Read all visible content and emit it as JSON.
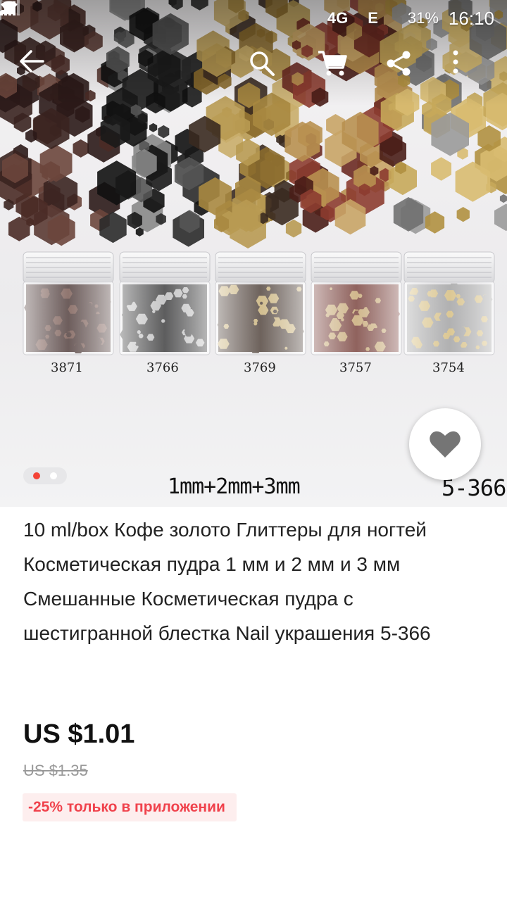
{
  "status_bar": {
    "network": "4G",
    "network_2": "E",
    "battery": "31%",
    "time": "16:10"
  },
  "toolbar": {
    "back_icon": "arrow-left-icon",
    "search_icon": "search-icon",
    "cart_icon": "cart-icon",
    "share_icon": "share-icon",
    "more_icon": "more-vertical-icon"
  },
  "gallery": {
    "image_count": 2,
    "active_index": 0,
    "jar_labels": [
      "3871",
      "3766",
      "3769",
      "3757",
      "3754"
    ],
    "caption_size": "1mm+2mm+3mm",
    "caption_code": "5-366"
  },
  "favorite": {
    "icon": "heart-icon"
  },
  "product": {
    "title": "10 ml/box Кофе золото Глиттеры для ногтей Косметическая пудра 1 мм и 2 мм и 3 мм Смешанные Косметическая пудра с шестигранной блестка Nail украшения 5-366",
    "price": "US $1.01",
    "old_price": "US $1.35",
    "promo": "-25% только в приложении"
  },
  "colors": {
    "accent": "#f44336",
    "promo_text": "#f0424c",
    "promo_bg": "#fdeeee"
  }
}
